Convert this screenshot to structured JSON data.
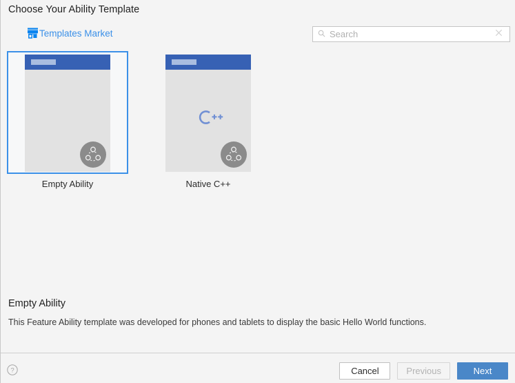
{
  "header": {
    "title": "Choose Your Ability Template",
    "market_link_label": "Templates Market",
    "market_icon": "shop-icon"
  },
  "search": {
    "placeholder": "Search",
    "value": "",
    "search_icon": "search-icon",
    "clear_icon": "close-icon"
  },
  "templates": [
    {
      "label": "Empty Ability",
      "selected": true,
      "badge_icon": "distributed-ability-icon",
      "logo": ""
    },
    {
      "label": "Native C++",
      "selected": false,
      "badge_icon": "distributed-ability-icon",
      "logo": "C++"
    }
  ],
  "description": {
    "title": "Empty Ability",
    "body": "This Feature Ability template was developed for phones and tablets to display the basic Hello World functions."
  },
  "footer": {
    "help_icon": "help-circle-icon",
    "cancel_label": "Cancel",
    "previous_label": "Previous",
    "next_label": "Next"
  },
  "colors": {
    "accent_blue": "#3b90e8",
    "primary_button": "#4a87c8",
    "thumb_bar": "#3761b4",
    "page_background": "#f4f4f4"
  }
}
